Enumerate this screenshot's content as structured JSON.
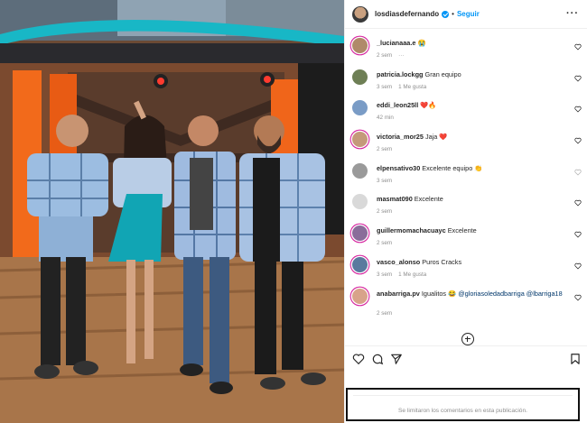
{
  "post": {
    "author": {
      "username": "losdiasdefernando",
      "verified_icon": "verified-badge-icon",
      "separator": "•",
      "follow_label": "Seguir",
      "more_icon": "more-options-icon",
      "more_label": "···"
    },
    "image": {
      "subject": "four-people-tv-studio-photo"
    }
  },
  "comments": [
    {
      "user": "_lucianaaa.e",
      "text": "",
      "emoji": "😭",
      "meta": [
        "2 sem",
        "···"
      ],
      "avatar_color": "#b08a6a",
      "ring": true
    },
    {
      "user": "patricia.lockgg",
      "text": "Gran equipo",
      "emoji": "",
      "meta": [
        "3 sem",
        "1 Me gusta"
      ],
      "avatar_color": "#6e7f55",
      "ring": false
    },
    {
      "user": "eddi_leon25ll",
      "text": "",
      "emoji": "❤️🔥",
      "meta": [
        "42 min"
      ],
      "avatar_color": "#7a9cc6",
      "ring": false
    },
    {
      "user": "victoria_mor25",
      "text": "Jaja",
      "emoji": "❤️",
      "meta": [
        "2 sem"
      ],
      "avatar_color": "#c49a7a",
      "ring": true
    },
    {
      "user": "elpensativo30",
      "text": "Excelente equipo",
      "emoji": "👏",
      "meta": [
        "3 sem"
      ],
      "avatar_color": "#9a9a9a",
      "ring": false
    },
    {
      "user": "masmat090",
      "text": "Excelente",
      "emoji": "",
      "meta": [
        "2 sem"
      ],
      "avatar_color": "#d9d9d9",
      "ring": false
    },
    {
      "user": "guillermomachacuayc",
      "text": "Excelente",
      "emoji": "",
      "meta": [
        "2 sem"
      ],
      "avatar_color": "#8a6d9a",
      "ring": true
    },
    {
      "user": "vasco_alonso",
      "text": "Puros Cracks",
      "emoji": "",
      "meta": [
        "3 sem",
        "1 Me gusta"
      ],
      "avatar_color": "#5b7a9e",
      "ring": true
    },
    {
      "user": "anabarriga.pv",
      "text": "Igualitos",
      "emoji": "😂",
      "mentions": "@gloriasoledadbarriga @lbarriga18",
      "meta": [
        "2 sem"
      ],
      "avatar_color": "#d8a38a",
      "ring": true
    }
  ],
  "add_comments_icon": "plus-circle-icon",
  "actions": {
    "like_icon": "heart-icon",
    "comment_icon": "comment-icon",
    "share_icon": "paper-plane-icon",
    "save_icon": "bookmark-icon"
  },
  "comments_limited_text": "Se limitaron los comentarios en esta publicación.",
  "colors": {
    "accent": "#0095f6",
    "muted": "#8e8e8e",
    "heart_red": "#ed4956",
    "mention": "#00376b"
  }
}
